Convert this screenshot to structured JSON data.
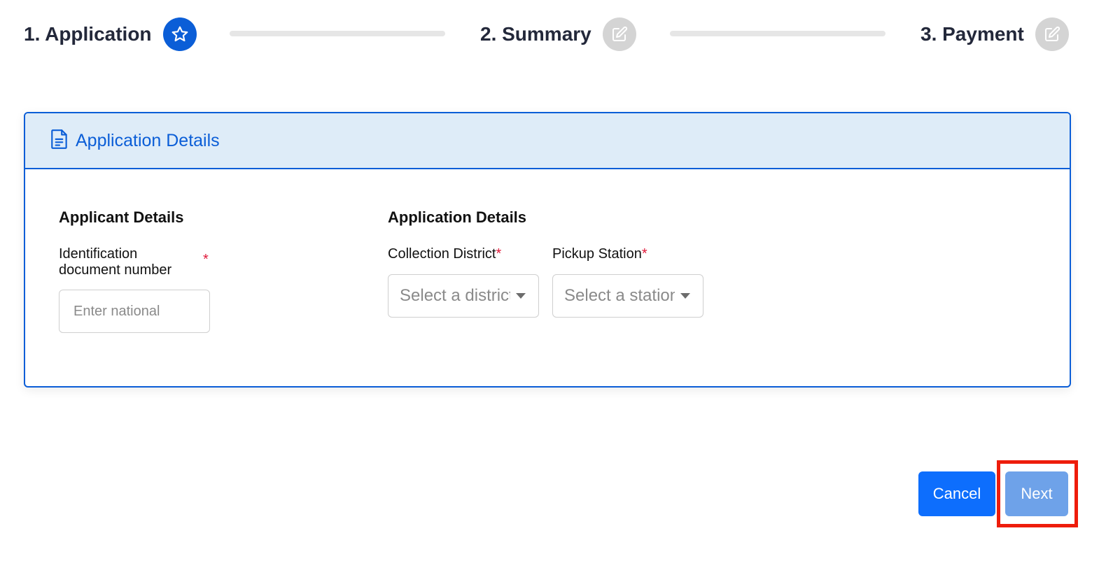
{
  "stepper": {
    "steps": [
      {
        "label": "1. Application",
        "icon": "star-icon",
        "state": "active"
      },
      {
        "label": "2. Summary",
        "icon": "edit-icon",
        "state": "inactive"
      },
      {
        "label": "3. Payment",
        "icon": "edit-icon",
        "state": "inactive"
      }
    ]
  },
  "card": {
    "header_title": "Application Details",
    "header_icon": "document-icon",
    "applicant_section": {
      "title": "Applicant Details",
      "id_label": "Identification document number",
      "id_required": "*",
      "id_placeholder": "Enter national",
      "id_value": ""
    },
    "application_section": {
      "title": "Application Details",
      "district_label": "Collection District",
      "district_required": "*",
      "district_placeholder": "Select a district",
      "station_label": "Pickup Station",
      "station_required": "*",
      "station_placeholder": "Select a station"
    }
  },
  "actions": {
    "cancel_label": "Cancel",
    "next_label": "Next"
  },
  "colors": {
    "primary": "#0b5ed7",
    "header_bg": "#deecf8",
    "required": "#e0193a",
    "highlight": "#ee1c0b",
    "next_disabled": "#6ea2e9"
  }
}
